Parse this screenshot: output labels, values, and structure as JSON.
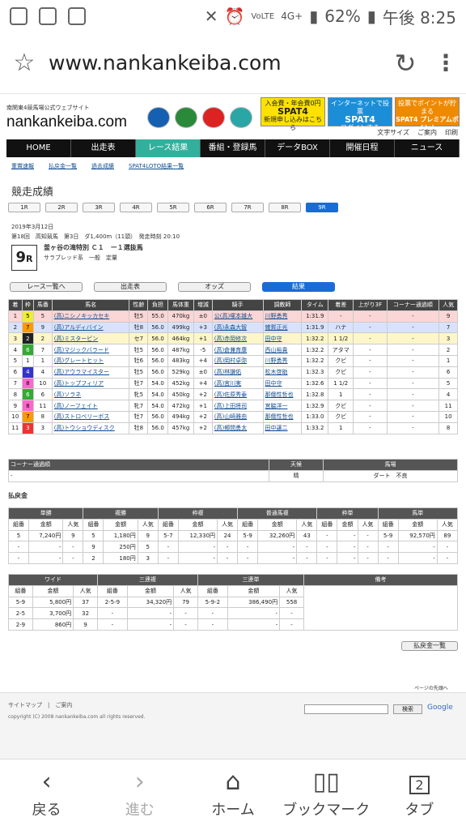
{
  "status": {
    "left_icons": [
      "notification-icon",
      "shield-icon",
      "voicemail-icon"
    ],
    "battery": "62%",
    "time": "午後 8:25",
    "network": "4G+",
    "volte": "VoLTE"
  },
  "browser": {
    "url": "www.nankankeiba.com"
  },
  "site": {
    "tagline": "南関東4競馬場公式ウェブサイト",
    "logo": "nankankeiba.com",
    "banners": [
      {
        "top": "入会費・年会費0円",
        "main": "SPAT4",
        "sub": "新規申し込みはこちら",
        "color": "#ffe100"
      },
      {
        "top": "インターネットで投票",
        "main": "SPAT4",
        "sub": "ログインする",
        "color": "#1c8ed8"
      },
      {
        "top": "投票でポイントが貯まる",
        "main": "SPAT4 プレミアムポイント",
        "sub": "ログインする",
        "color": "#ef8a00"
      }
    ],
    "tools": [
      "文字サイズ",
      "ご案内",
      "印刷"
    ],
    "nav": [
      "HOME",
      "出走表",
      "レース結果",
      "番組・登録馬",
      "データBOX",
      "開催日程",
      "ニュース"
    ],
    "subnav": [
      "重賞速報",
      "払戻金一覧",
      "過去成績",
      "SPAT4LOTO結果一覧"
    ],
    "heading": "競走成績",
    "race_tabs": [
      "1R",
      "2R",
      "3R",
      "4R",
      "5R",
      "6R",
      "7R",
      "8R",
      "9R"
    ],
    "race": {
      "date": "2019年3月12日",
      "meeting": "第18回　高知競馬　第3日",
      "dist": "ダ1,400m（11頭）　発走時刻 20:10",
      "name": "釜ヶ谷の滝特別 Ｃ１　ー１選抜馬",
      "cond": "サラブレッド系　一般　定量",
      "num": "9",
      "unit": "R"
    },
    "buttons": [
      "レース一覧へ",
      "出走表",
      "オッズ",
      "結果"
    ],
    "results_header": [
      "着",
      "枠",
      "馬番",
      "馬名",
      "性齢",
      "負担",
      "馬体重",
      "増減",
      "騎手",
      "調教師",
      "タイム",
      "着差",
      "上がり3F",
      "コーナー通過順",
      "人気"
    ],
    "results": [
      [
        "1",
        "5",
        "5",
        "(高)ニシノキッカセキ",
        "牡5",
        "55.0",
        "470kg",
        "±0",
        "公(高)塚本雄大",
        "川野勇秀",
        "1:31.9",
        "-",
        "-",
        "-",
        "9"
      ],
      [
        "2",
        "7",
        "9",
        "(高)アルディバイン",
        "牡8",
        "56.0",
        "499kg",
        "+3",
        "(高)永森大智",
        "雑賀正光",
        "1:31.9",
        "ハナ",
        "-",
        "-",
        "7"
      ],
      [
        "3",
        "2",
        "2",
        "(高)ミスタービン",
        "セ7",
        "56.0",
        "464kg",
        "+1",
        "(高)赤岡修次",
        "田中守",
        "1:32.2",
        "1 1/2",
        "-",
        "-",
        "3"
      ],
      [
        "4",
        "6",
        "7",
        "(高)マジックバラード",
        "牡5",
        "56.0",
        "487kg",
        "-5",
        "(高)倉兼育康",
        "西山裕貴",
        "1:32.2",
        "アタマ",
        "-",
        "-",
        "2"
      ],
      [
        "5",
        "1",
        "1",
        "(高)グレートヒット",
        "牡6",
        "56.0",
        "483kg",
        "+4",
        "(高)岡村卓弥",
        "川野勇秀",
        "1:32.2",
        "クビ",
        "-",
        "-",
        "1"
      ],
      [
        "6",
        "4",
        "4",
        "(高)アウラマイスター",
        "牡5",
        "56.0",
        "529kg",
        "±0",
        "(高)林謙佑",
        "松木啓助",
        "1:32.3",
        "クビ",
        "-",
        "-",
        "6"
      ],
      [
        "7",
        "8",
        "10",
        "(高)トップフィリア",
        "牡7",
        "54.0",
        "452kg",
        "+4",
        "(高)宮川実",
        "田中守",
        "1:32.6",
        "1 1/2",
        "-",
        "-",
        "5"
      ],
      [
        "8",
        "6",
        "6",
        "(高)ソラネ",
        "牝5",
        "54.0",
        "450kg",
        "+2",
        "(高)佐原秀泰",
        "那俄性哲也",
        "1:32.8",
        "1",
        "-",
        "-",
        "4"
      ],
      [
        "9",
        "8",
        "11",
        "(高)ノーフェイト",
        "牝7",
        "54.0",
        "472kg",
        "+1",
        "(高)上田将司",
        "宮脇洋一",
        "1:32.9",
        "クビ",
        "-",
        "-",
        "11"
      ],
      [
        "10",
        "7",
        "8",
        "(高)ストロベリーボス",
        "牡7",
        "56.0",
        "494kg",
        "+2",
        "(高)山崎雅由",
        "那俄性哲也",
        "1:33.0",
        "クビ",
        "-",
        "-",
        "10"
      ],
      [
        "11",
        "3",
        "3",
        "(高)トウショウディスク",
        "牡8",
        "56.0",
        "457kg",
        "+2",
        "(高)郷間勇太",
        "田中譲二",
        "1:33.2",
        "1",
        "-",
        "-",
        "8"
      ]
    ],
    "corner": {
      "title": "コーナー通過順",
      "weather_h": "天候",
      "track_h": "馬場",
      "weather": "晴",
      "track": "ダート　不良",
      "left": "-"
    },
    "payout_title": "払戻金",
    "pay1": {
      "groups": [
        "単勝",
        "複勝",
        "枠複",
        "普通馬複",
        "枠単",
        "馬単"
      ],
      "sub": [
        "組番",
        "金額",
        "人気"
      ],
      "rows": [
        [
          "5",
          "7,240円",
          "9",
          "5",
          "1,180円",
          "9",
          "5-7",
          "12,330円",
          "24",
          "5-9",
          "32,260円",
          "43",
          "-",
          "-",
          "-",
          "5-9",
          "92,570円",
          "89"
        ],
        [
          "-",
          "-",
          "-",
          "9",
          "250円",
          "5",
          "-",
          "-",
          "-",
          "-",
          "-",
          "-",
          "-",
          "-",
          "-",
          "-",
          "-",
          "-"
        ],
        [
          "-",
          "-",
          "-",
          "2",
          "180円",
          "3",
          "-",
          "-",
          "-",
          "-",
          "-",
          "-",
          "-",
          "-",
          "-",
          "-",
          "-",
          "-"
        ]
      ]
    },
    "pay2": {
      "groups": [
        "ワイド",
        "三連複",
        "三連単",
        "備考"
      ],
      "sub": [
        "組番",
        "金額",
        "人気"
      ],
      "rows": [
        [
          "5-9",
          "5,800円",
          "37",
          "2-5-9",
          "34,320円",
          "79",
          "5-9-2",
          "386,490円",
          "558"
        ],
        [
          "2-5",
          "3,700円",
          "32",
          "-",
          "-",
          "-",
          "-",
          "-",
          "-"
        ],
        [
          "2-9",
          "860円",
          "9",
          "-",
          "-",
          "-",
          "-",
          "-",
          "-"
        ]
      ]
    },
    "payout_list_btn": "払戻金一覧",
    "page_top": "ページの先頭へ",
    "footer": {
      "links": [
        "サイトマップ",
        "ご案内"
      ],
      "copy": "copyright (C) 2008 nankankeiba.com all rights reserved.",
      "search_btn": "検索",
      "google": "Google"
    }
  },
  "bottom": [
    "戻る",
    "進む",
    "ホーム",
    "ブックマーク",
    "タブ"
  ],
  "tab_count": "2"
}
